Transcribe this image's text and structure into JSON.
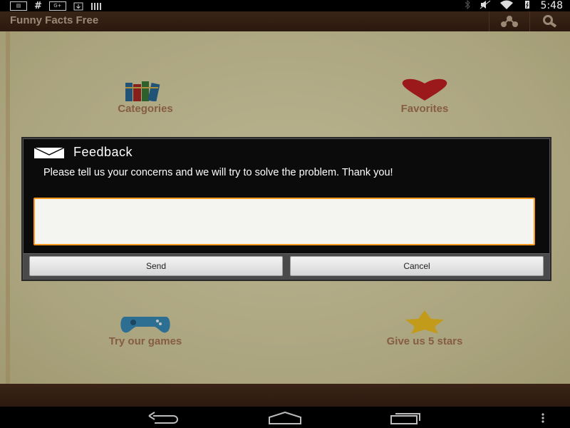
{
  "status_bar": {
    "left_icons": [
      "news-icon",
      "hash-icon",
      "google-plus-icon",
      "download-icon",
      "barcode-icon"
    ],
    "google_plus_label": "G+",
    "hash_label": "#",
    "right_icons": [
      "bluetooth-icon",
      "mute-icon",
      "wifi-icon",
      "battery-icon"
    ],
    "time": "5:48"
  },
  "action_bar": {
    "title": "Funny Facts Free",
    "actions": [
      "share-icon",
      "search-icon"
    ]
  },
  "home_tiles": [
    {
      "label": "Categories",
      "icon": "books-icon"
    },
    {
      "label": "Favorites",
      "icon": "heart-icon"
    },
    {
      "label": "Try our games",
      "icon": "gamepad-icon"
    },
    {
      "label": "Give us 5 stars",
      "icon": "star-icon"
    }
  ],
  "dialog": {
    "title": "Feedback",
    "icon": "envelope-icon",
    "message": "Please tell us your concerns and we will try to solve the problem. Thank you!",
    "input_value": "",
    "send_label": "Send",
    "cancel_label": "Cancel"
  },
  "nav_bar": {
    "buttons": [
      "back-icon",
      "home-icon",
      "recents-icon",
      "menu-icon"
    ]
  },
  "colors": {
    "accent_focus": "#ff9a1f",
    "bar_brown": "#2c190f",
    "tile_label": "#9b6a4c"
  }
}
